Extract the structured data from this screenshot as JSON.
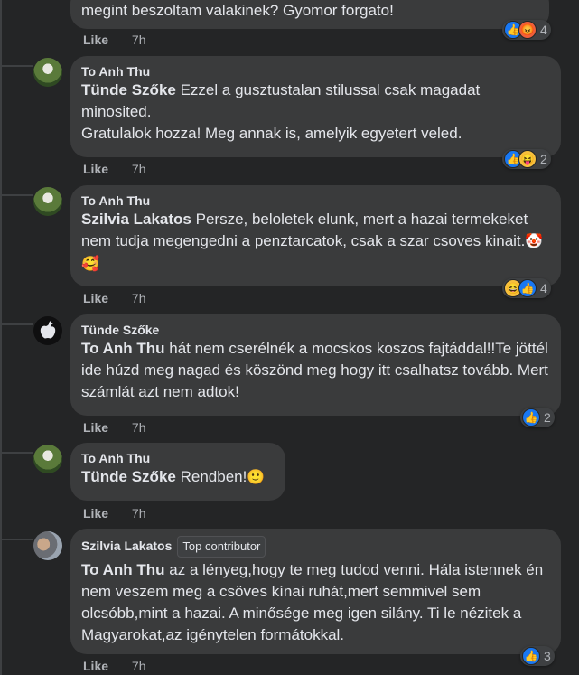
{
  "comments": [
    {
      "text_line": "megint beszoltam valakinek? Gyomor forgato!",
      "like": "Like",
      "time": "7h",
      "reactions": {
        "icons": [
          "like-icon",
          "angry-icon"
        ],
        "count": "4"
      }
    },
    {
      "author": "To Anh Thu",
      "mention": "Tünde Szőke",
      "text": "Ezzel a gusztustalan stilussal csak magadat minosited.",
      "text2": "Gratulalok hozza! Meg annak is, amelyik egyetert veled.",
      "like": "Like",
      "time": "7h",
      "reactions": {
        "icons": [
          "like-icon",
          "haha-icon"
        ],
        "count": "2"
      }
    },
    {
      "author": "To Anh Thu",
      "mention": "Szilvia Lakatos",
      "text": "Persze, beloletek elunk, mert a hazai termekeket nem tudja megengedni a penztarcatok, csak a szar csoves kinait.",
      "emojis": "🤡🥰",
      "like": "Like",
      "time": "7h",
      "reactions": {
        "icons": [
          "haha-icon",
          "like-icon"
        ],
        "count": "4"
      }
    },
    {
      "author": "Tünde Szőke",
      "mention": "To Anh Thu",
      "text": "hát nem cserélnék a mocskos koszos fajtáddal!!Te jöttél ide húzd meg nagad és köszönd meg hogy itt csalhatsz tovább. Mert számlát azt nem adtok!",
      "like": "Like",
      "time": "7h",
      "reactions": {
        "icons": [
          "like-icon"
        ],
        "count": "2"
      }
    },
    {
      "author": "To Anh Thu",
      "mention": "Tünde Szőke",
      "text": "Rendben!",
      "emojis": "🙂",
      "like": "Like",
      "time": "7h"
    },
    {
      "author": "Szilvia Lakatos",
      "badge": "Top contributor",
      "mention": "To Anh Thu",
      "text": "az a lényeg,hogy te meg tudod venni. Hála istennek én nem veszem meg a csöves kínai ruhát,mert semmivel sem olcsóbb,mint a hazai. A minősége meg igen silány. Ti le nézitek a Magyarokat,az igénytelen formátokkal.",
      "like": "Like",
      "time": "7h",
      "reactions": {
        "icons": [
          "like-icon"
        ],
        "count": "3"
      }
    }
  ]
}
